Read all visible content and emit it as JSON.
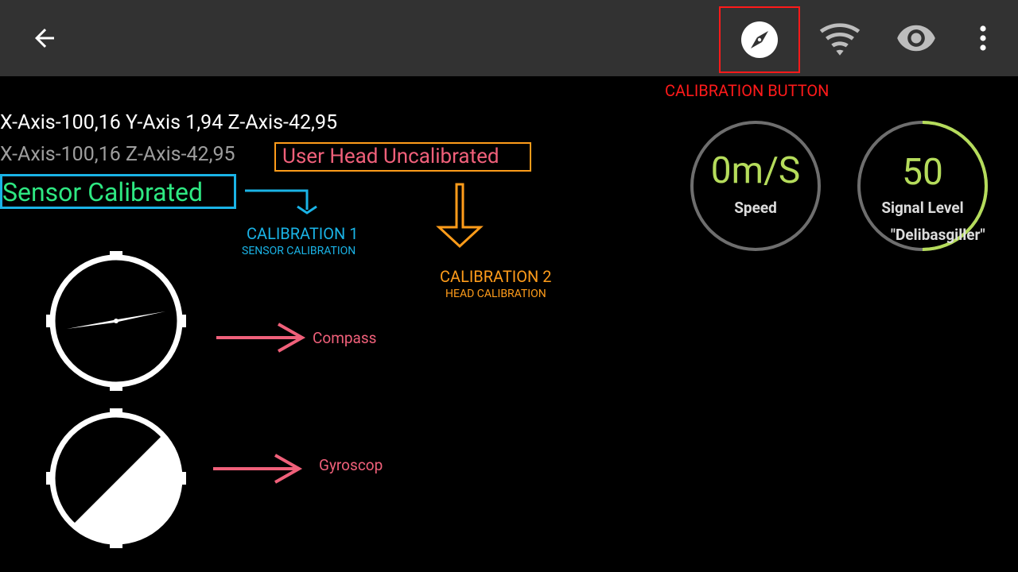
{
  "appbar": {
    "back_icon": "arrow-back-icon",
    "actions": [
      "compass-icon",
      "wifi-icon",
      "eye-icon",
      "more-vert-icon"
    ]
  },
  "annotations": {
    "calibration_button": "CALIBRATION BUTTON",
    "calibration1_title": "CALIBRATION 1",
    "calibration1_sub": "SENSOR CALIBRATION",
    "calibration2_title": "CALIBRATION 2",
    "calibration2_sub": "HEAD CALIBRATION",
    "compass": "Compass",
    "gyroscope": "Gyroscop"
  },
  "sensor": {
    "line1": "X-Axis-100,16 Y-Axis 1,94 Z-Axis-42,95",
    "line2": "X-Axis-100,16 Z-Axis-42,95",
    "head_status": "User Head Uncalibrated",
    "sensor_status": "Sensor Calibrated"
  },
  "gauges": {
    "speed": {
      "value": "0m/S",
      "label": "Speed"
    },
    "signal": {
      "value": "50",
      "label": "Signal Level",
      "network": "\"Delibasgiller\"",
      "level_fraction": 0.5
    }
  },
  "colors": {
    "red": "#ff1a1a",
    "blue": "#1ab3e6",
    "orange": "#ff9c1a",
    "pink": "#f0607a",
    "green": "#2ee882",
    "lime": "#b5dc5b",
    "gray": "#9e9e9e"
  }
}
